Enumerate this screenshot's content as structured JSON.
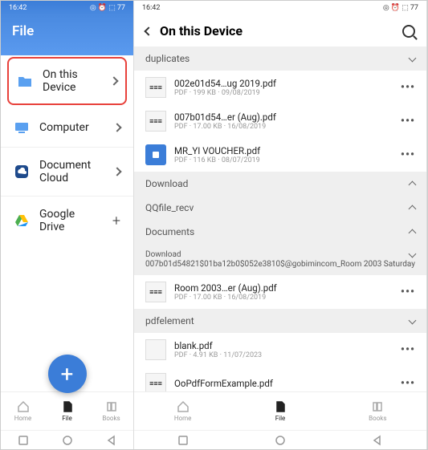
{
  "left": {
    "status": {
      "time": "16:42",
      "battery": "77"
    },
    "header": "File",
    "items": [
      {
        "label": "On this Device",
        "icon": "folder",
        "action": "chevron",
        "highlight": true
      },
      {
        "label": "Computer",
        "icon": "computer",
        "action": "chevron"
      },
      {
        "label": "Document Cloud",
        "icon": "cloud",
        "action": "chevron"
      },
      {
        "label": "Google Drive",
        "icon": "drive",
        "action": "plus"
      }
    ]
  },
  "right": {
    "status": {
      "time": "16:42",
      "battery": "77"
    },
    "title": "On this Device",
    "sections": [
      {
        "label": "duplicates",
        "state": "down",
        "files": [
          {
            "name": "002e01d54…ug 2019.pdf",
            "meta": "PDF · 199 KB · 09/08/2019",
            "thumb": "text"
          },
          {
            "name": "007b01d54…er (Aug).pdf",
            "meta": "PDF · 17.00 KB · 16/08/2019",
            "thumb": "text"
          },
          {
            "name": "MR_YI VOUCHER.pdf",
            "meta": "PDF · 116 KB · 08/07/2019",
            "thumb": "pdf"
          }
        ]
      },
      {
        "label": "Download",
        "state": "up"
      },
      {
        "label": "QQfile_recv",
        "state": "up"
      },
      {
        "label": "Documents",
        "state": "up"
      },
      {
        "label": "Download",
        "state": "down",
        "path": "007b01d54821$01ba12b0$052e3810$@gobimincom_Room 2003 Saturday",
        "files": [
          {
            "name": "Room 2003…er (Aug).pdf",
            "meta": "PDF · 17.00 KB · 16/08/2019",
            "thumb": "text"
          }
        ]
      },
      {
        "label": "pdfelement",
        "state": "down",
        "files": [
          {
            "name": "blank.pdf",
            "meta": "PDF · 4.91 KB · 11/07/2023",
            "thumb": "blank"
          },
          {
            "name": "OoPdfFormExample.pdf",
            "meta": "",
            "thumb": "text"
          }
        ]
      }
    ]
  },
  "nav": [
    {
      "label": "Home",
      "active": false
    },
    {
      "label": "File",
      "active": true
    },
    {
      "label": "Books",
      "active": false
    }
  ]
}
